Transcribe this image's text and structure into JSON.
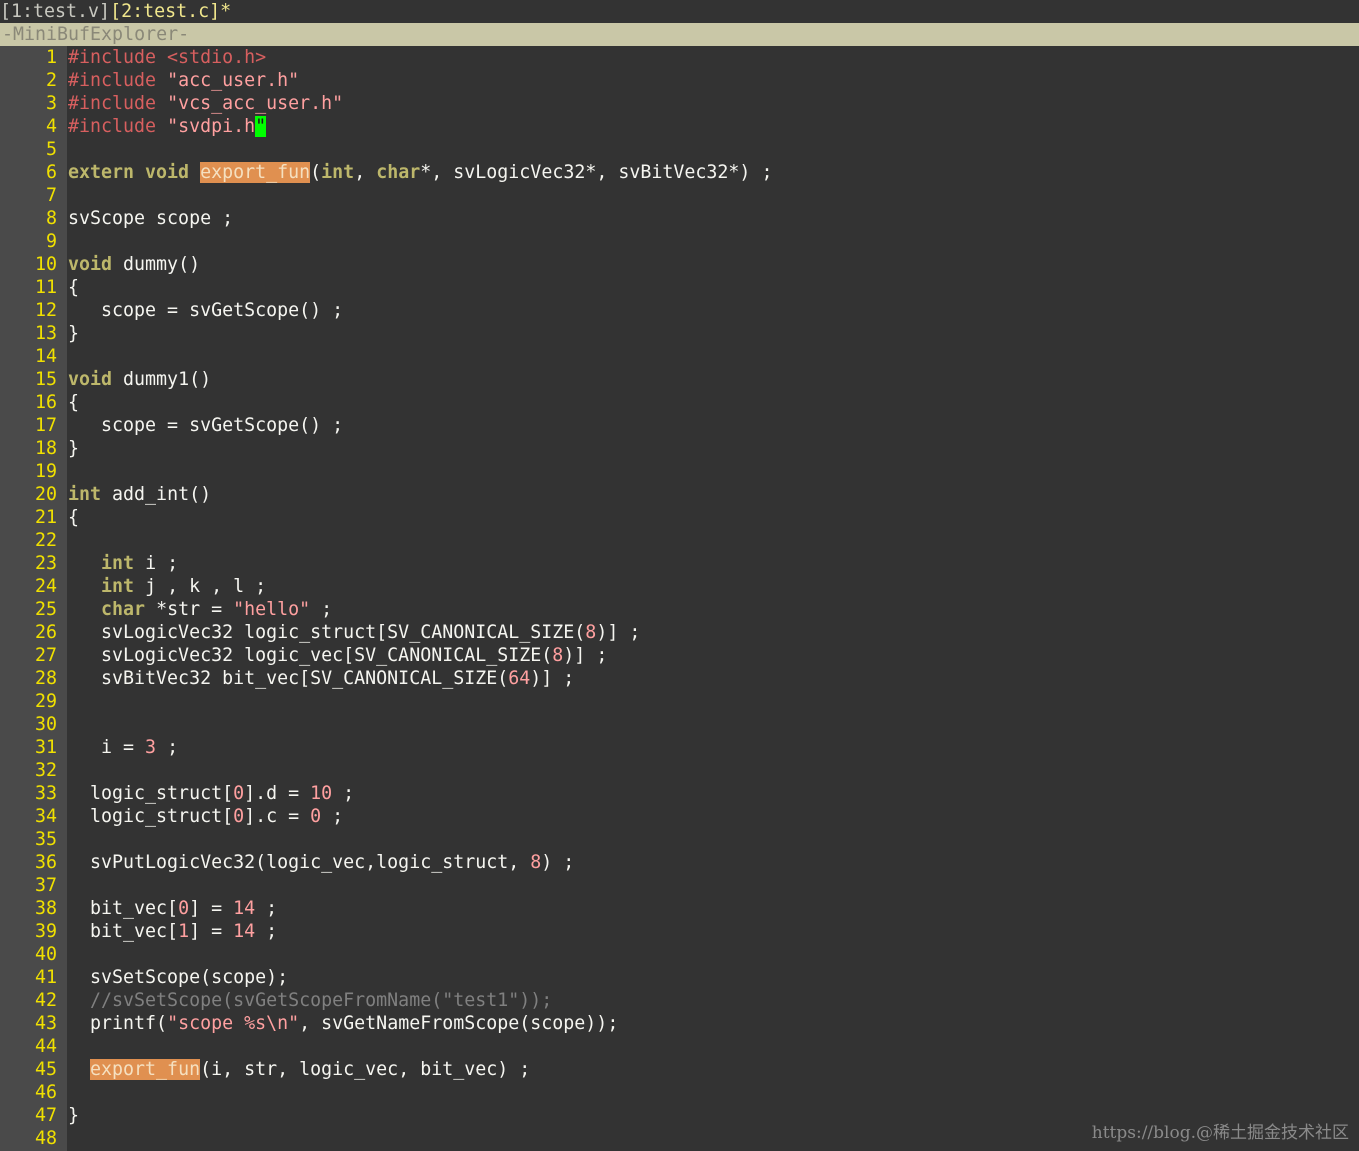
{
  "buffers": [
    {
      "label": "[1:test.v]",
      "active": false
    },
    {
      "label": "[2:test.c]*",
      "active": true
    }
  ],
  "status_label": "-MiniBufExplorer-",
  "watermark": "https://blog.@稀土掘金技术社区",
  "lines": [
    [
      {
        "t": "#include <stdio.h>",
        "c": "pp"
      }
    ],
    [
      {
        "t": "#include ",
        "c": "pp"
      },
      {
        "t": "\"acc_user.h\"",
        "c": "str"
      }
    ],
    [
      {
        "t": "#include ",
        "c": "pp"
      },
      {
        "t": "\"vcs_acc_user.h\"",
        "c": "str"
      }
    ],
    [
      {
        "t": "#include ",
        "c": "pp"
      },
      {
        "t": "\"svdpi.h",
        "c": "str"
      },
      {
        "t": "\"",
        "c": "cursor"
      }
    ],
    [],
    [
      {
        "t": "extern void",
        "c": "ty"
      },
      {
        "t": " ",
        "c": ""
      },
      {
        "t": "export_fun",
        "c": "fn-hl"
      },
      {
        "t": "(",
        "c": ""
      },
      {
        "t": "int",
        "c": "ty"
      },
      {
        "t": ", ",
        "c": ""
      },
      {
        "t": "char",
        "c": "ty"
      },
      {
        "t": "*, svLogicVec32*, svBitVec32*) ;",
        "c": ""
      }
    ],
    [],
    [
      {
        "t": "svScope scope ;",
        "c": ""
      }
    ],
    [],
    [
      {
        "t": "void",
        "c": "ty"
      },
      {
        "t": " dummy()",
        "c": ""
      }
    ],
    [
      {
        "t": "{",
        "c": ""
      }
    ],
    [
      {
        "t": "   scope = svGetScope() ;",
        "c": ""
      }
    ],
    [
      {
        "t": "}",
        "c": ""
      }
    ],
    [],
    [
      {
        "t": "void",
        "c": "ty"
      },
      {
        "t": " dummy1()",
        "c": ""
      }
    ],
    [
      {
        "t": "{",
        "c": ""
      }
    ],
    [
      {
        "t": "   scope = svGetScope() ;",
        "c": ""
      }
    ],
    [
      {
        "t": "}",
        "c": ""
      }
    ],
    [],
    [
      {
        "t": "int",
        "c": "ty"
      },
      {
        "t": " add_int()",
        "c": ""
      }
    ],
    [
      {
        "t": "{",
        "c": ""
      }
    ],
    [],
    [
      {
        "t": "   ",
        "c": ""
      },
      {
        "t": "int",
        "c": "ty"
      },
      {
        "t": " i ;",
        "c": ""
      }
    ],
    [
      {
        "t": "   ",
        "c": ""
      },
      {
        "t": "int",
        "c": "ty"
      },
      {
        "t": " j , k , l ;",
        "c": ""
      }
    ],
    [
      {
        "t": "   ",
        "c": ""
      },
      {
        "t": "char",
        "c": "ty"
      },
      {
        "t": " *str = ",
        "c": ""
      },
      {
        "t": "\"hello\"",
        "c": "str"
      },
      {
        "t": " ;",
        "c": ""
      }
    ],
    [
      {
        "t": "   svLogicVec32 logic_struct[SV_CANONICAL_SIZE(",
        "c": ""
      },
      {
        "t": "8",
        "c": "num"
      },
      {
        "t": ")] ;",
        "c": ""
      }
    ],
    [
      {
        "t": "   svLogicVec32 logic_vec[SV_CANONICAL_SIZE(",
        "c": ""
      },
      {
        "t": "8",
        "c": "num"
      },
      {
        "t": ")] ;",
        "c": ""
      }
    ],
    [
      {
        "t": "   svBitVec32 bit_vec[SV_CANONICAL_SIZE(",
        "c": ""
      },
      {
        "t": "64",
        "c": "num"
      },
      {
        "t": ")] ;",
        "c": ""
      }
    ],
    [],
    [],
    [
      {
        "t": "   i = ",
        "c": ""
      },
      {
        "t": "3",
        "c": "num"
      },
      {
        "t": " ;",
        "c": ""
      }
    ],
    [],
    [
      {
        "t": "  logic_struct[",
        "c": ""
      },
      {
        "t": "0",
        "c": "num"
      },
      {
        "t": "].d = ",
        "c": ""
      },
      {
        "t": "10",
        "c": "num"
      },
      {
        "t": " ;",
        "c": ""
      }
    ],
    [
      {
        "t": "  logic_struct[",
        "c": ""
      },
      {
        "t": "0",
        "c": "num"
      },
      {
        "t": "].c = ",
        "c": ""
      },
      {
        "t": "0",
        "c": "num"
      },
      {
        "t": " ;",
        "c": ""
      }
    ],
    [],
    [
      {
        "t": "  svPutLogicVec32(logic_vec,logic_struct, ",
        "c": ""
      },
      {
        "t": "8",
        "c": "num"
      },
      {
        "t": ") ;",
        "c": ""
      }
    ],
    [],
    [
      {
        "t": "  bit_vec[",
        "c": ""
      },
      {
        "t": "0",
        "c": "num"
      },
      {
        "t": "] = ",
        "c": ""
      },
      {
        "t": "14",
        "c": "num"
      },
      {
        "t": " ;",
        "c": ""
      }
    ],
    [
      {
        "t": "  bit_vec[",
        "c": ""
      },
      {
        "t": "1",
        "c": "num"
      },
      {
        "t": "] = ",
        "c": ""
      },
      {
        "t": "14",
        "c": "num"
      },
      {
        "t": " ;",
        "c": ""
      }
    ],
    [],
    [
      {
        "t": "  svSetScope(scope);",
        "c": ""
      }
    ],
    [
      {
        "t": "  //svSetScope(svGetScopeFromName(\"test1\"));",
        "c": "cm"
      }
    ],
    [
      {
        "t": "  printf(",
        "c": ""
      },
      {
        "t": "\"scope %s\\n\"",
        "c": "str"
      },
      {
        "t": ", svGetNameFromScope(scope));",
        "c": ""
      }
    ],
    [],
    [
      {
        "t": "  ",
        "c": ""
      },
      {
        "t": "export_fun",
        "c": "fn-hl"
      },
      {
        "t": "(i, str, logic_vec, bit_vec) ;",
        "c": ""
      }
    ],
    [],
    [
      {
        "t": "}",
        "c": ""
      }
    ],
    []
  ]
}
